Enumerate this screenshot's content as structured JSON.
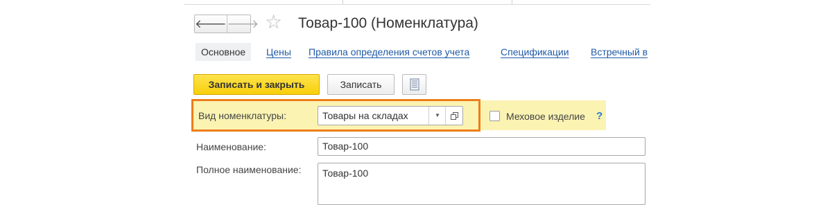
{
  "window": {
    "title": "Товар-100 (Номенклатура)",
    "back_icon": "arrow-left-icon",
    "forward_icon": "arrow-right-icon",
    "favorite_icon": "star-icon"
  },
  "tabs": [
    {
      "label": "Основное",
      "active": true
    },
    {
      "label": "Цены",
      "active": false
    },
    {
      "label": "Правила определения счетов учета",
      "active": false
    },
    {
      "label": "Спецификации",
      "active": false
    },
    {
      "label": "Встречный в",
      "active": false
    }
  ],
  "toolbar": {
    "save_close_label": "Записать и закрыть",
    "save_label": "Записать",
    "report_icon": "document-list-icon"
  },
  "form": {
    "kind": {
      "label": "Вид номенклатуры:",
      "value": "Товары на складах",
      "dropdown_icon": "triangle-down-icon",
      "open_icon": "open-window-icon"
    },
    "fur": {
      "label": "Меховое изделие",
      "checked": false,
      "help": "?"
    },
    "name": {
      "label": "Наименование:",
      "value": "Товар-100"
    },
    "full_name": {
      "label": "Полное наименование:",
      "value": "Товар-100"
    }
  },
  "colors": {
    "accent": "#f7cf0c",
    "highlight_border": "#ec7e1a",
    "field_highlight_bg": "#fbf3b2",
    "link": "#1f5aa6",
    "help": "#1f7ad1"
  }
}
